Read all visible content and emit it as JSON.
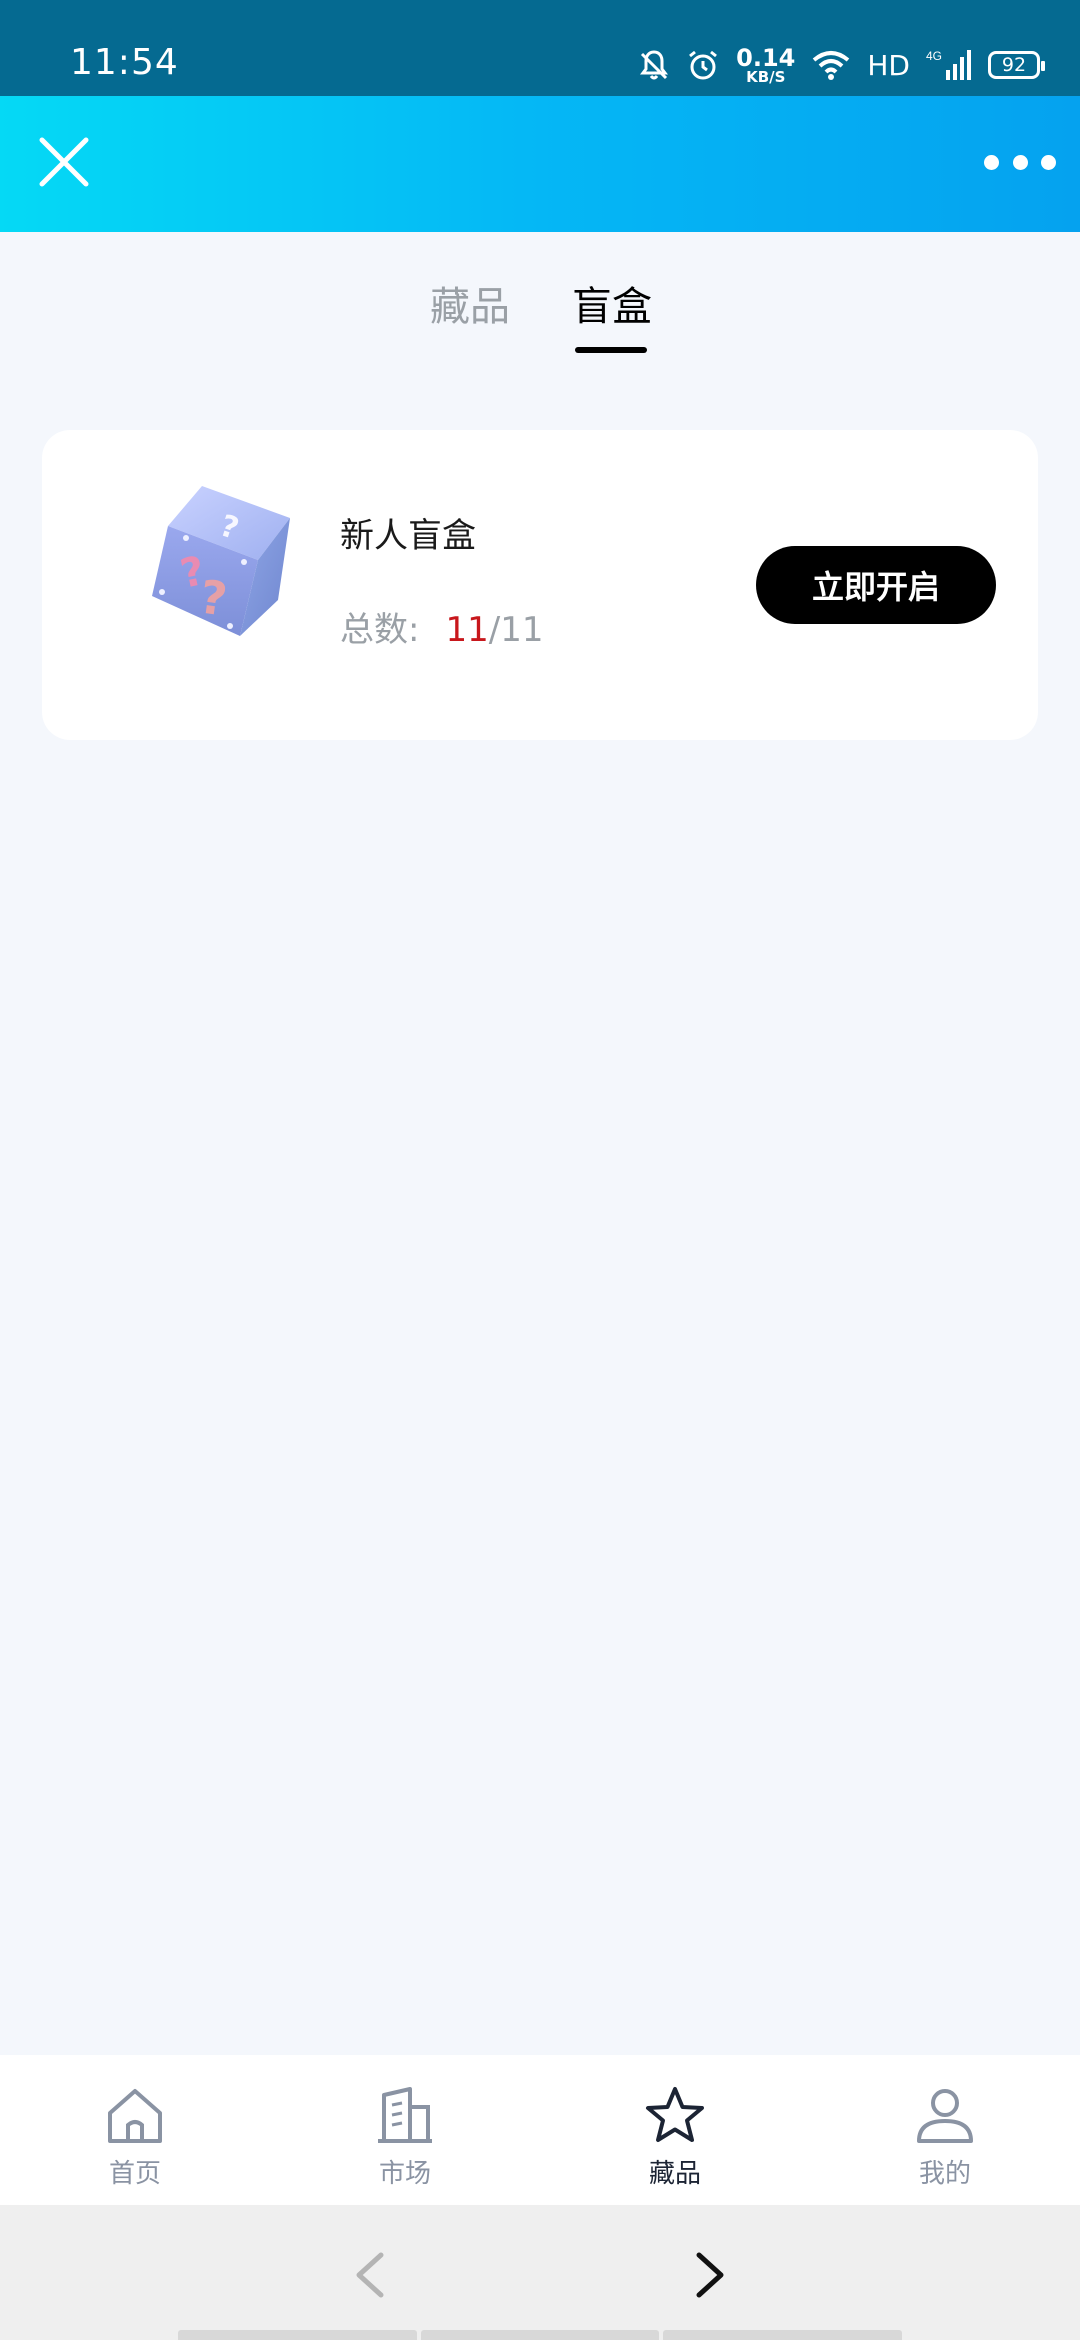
{
  "status_bar": {
    "time": "11:54",
    "net_speed_value": "0.14",
    "net_speed_unit": "KB/S",
    "hd": "HD",
    "network": "4G",
    "battery": "92"
  },
  "header": {
    "close_icon": "close-icon",
    "more_icon": "more-dots-icon"
  },
  "tabs": [
    {
      "label": "藏品",
      "active": false
    },
    {
      "label": "盲盒",
      "active": true
    }
  ],
  "blind_box": {
    "title": "新人盲盒",
    "count_label": "总数:",
    "count_current": "11",
    "count_total": "/11",
    "open_button": "立即开启",
    "image_icon": "mystery-box-icon"
  },
  "bottom_nav": [
    {
      "label": "首页",
      "icon": "home-icon",
      "active": false
    },
    {
      "label": "市场",
      "icon": "building-icon",
      "active": false
    },
    {
      "label": "藏品",
      "icon": "star-icon",
      "active": true
    },
    {
      "label": "我的",
      "icon": "user-icon",
      "active": false
    }
  ],
  "colors": {
    "status_bar": "#056a91",
    "header_gradient_start": "#05d9f5",
    "header_gradient_end": "#05a2ef",
    "page_background": "#f4f7fc",
    "count_highlight": "#c8171c",
    "button_background": "#000000"
  }
}
